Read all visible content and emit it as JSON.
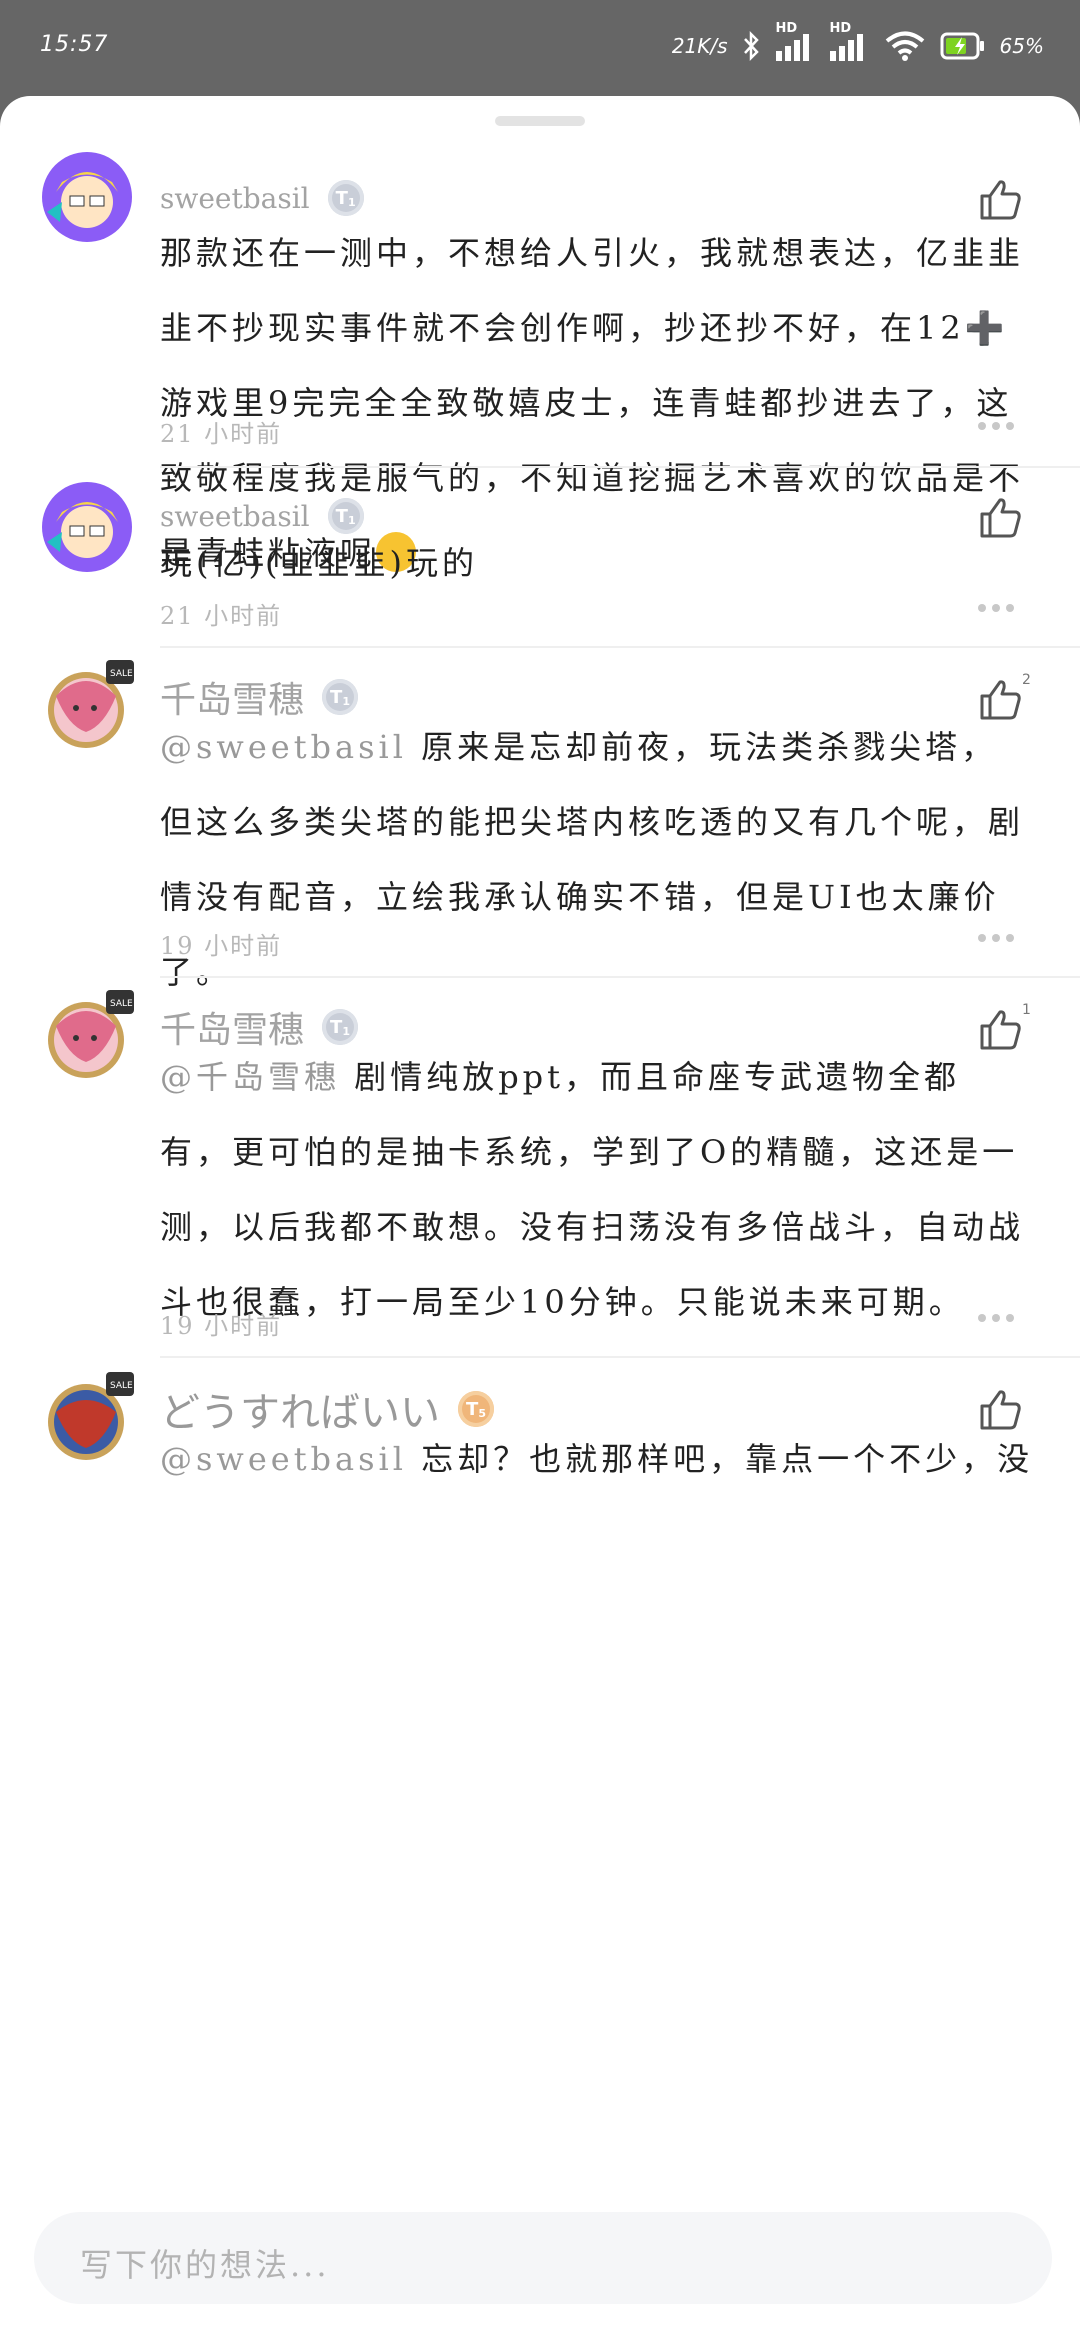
{
  "status_bar": {
    "time": "15:57",
    "net_speed": "21K/s",
    "hd_1": "HD",
    "hd_2": "HD",
    "battery": "65%"
  },
  "comments": [
    {
      "username": "sweetbasil",
      "level": "1",
      "text": "那款还在一测中，不想给人引火，我就想表达，亿韭韭韭不抄现实事件就不会创作啊，抄还抄不好，在12➕游戏里9完完全全致敬嬉皮士，连青蛙都抄进去了，这致敬程度我是服气的，不知道挖掘艺术喜欢的饮品是不是青蛙粘液呢",
      "time": "21 小时前"
    },
    {
      "username": "sweetbasil",
      "level": "1",
      "text": "玩(亿)(韭韭韭)玩的",
      "time": "21 小时前"
    },
    {
      "username": "千岛雪穗",
      "level": "1",
      "likes": "2",
      "mention": "@sweetbasil",
      "text": "原来是忘却前夜，玩法类杀戮尖塔，但这么多类尖塔的能把尖塔内核吃透的又有几个呢，剧情没有配音，立绘我承认确实不错，但是UI也太廉价了。",
      "time": "19 小时前"
    },
    {
      "username": "千岛雪穗",
      "level": "1",
      "likes": "1",
      "mention": "@千岛雪穗",
      "text": "剧情纯放ppt，而且命座专武遗物全都有，更可怕的是抽卡系统，学到了O的精髓，这还是一测，以后我都不敢想。没有扫荡没有多倍战斗，自动战斗也很蠢，打一局至少10分钟。只能说未来可期。",
      "time": "19 小时前"
    },
    {
      "username": "どうすればいい",
      "level": "5",
      "mention": "@sweetbasil",
      "text": "忘却？也就那样吧，靠点一个不少，没什"
    }
  ],
  "input": {
    "placeholder": "写下你的想法..."
  }
}
